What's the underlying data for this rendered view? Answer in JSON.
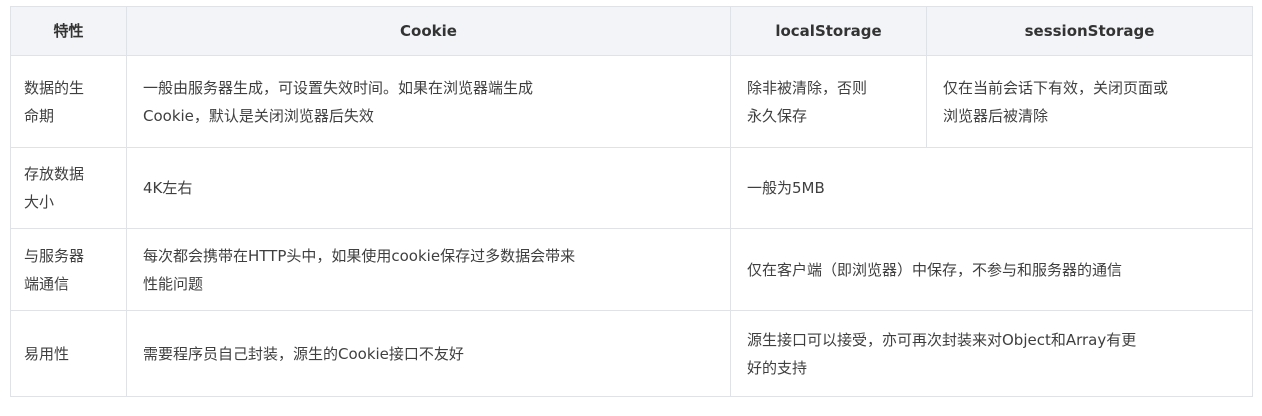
{
  "table": {
    "headers": [
      "特性",
      "Cookie",
      "localStorage",
      "sessionStorage"
    ],
    "rows": [
      {
        "feature": [
          "数据的生",
          "命期"
        ],
        "cookie": [
          "一般由服务器生成，可设置失效时间。如果在浏览器端生成",
          "Cookie，默认是关闭浏览器后失效"
        ],
        "local": [
          "除非被清除，否则",
          "永久保存"
        ],
        "session": [
          "仅在当前会话下有效，关闭页面或",
          "浏览器后被清除"
        ]
      },
      {
        "feature": [
          "存放数据",
          "大小"
        ],
        "cookie": [
          "4K左右"
        ],
        "storage": [
          "一般为5MB"
        ]
      },
      {
        "feature": [
          "与服务器",
          "端通信"
        ],
        "cookie": [
          "每次都会携带在HTTP头中，如果使用cookie保存过多数据会带来",
          "性能问题"
        ],
        "storage": [
          "仅在客户端（即浏览器）中保存，不参与和服务器的通信"
        ]
      },
      {
        "feature": [
          "易用性"
        ],
        "cookie": [
          "需要程序员自己封装，源生的Cookie接口不友好"
        ],
        "storage": [
          "源生接口可以接受，亦可再次封装来对Object和Array有更",
          "好的支持"
        ]
      }
    ]
  }
}
